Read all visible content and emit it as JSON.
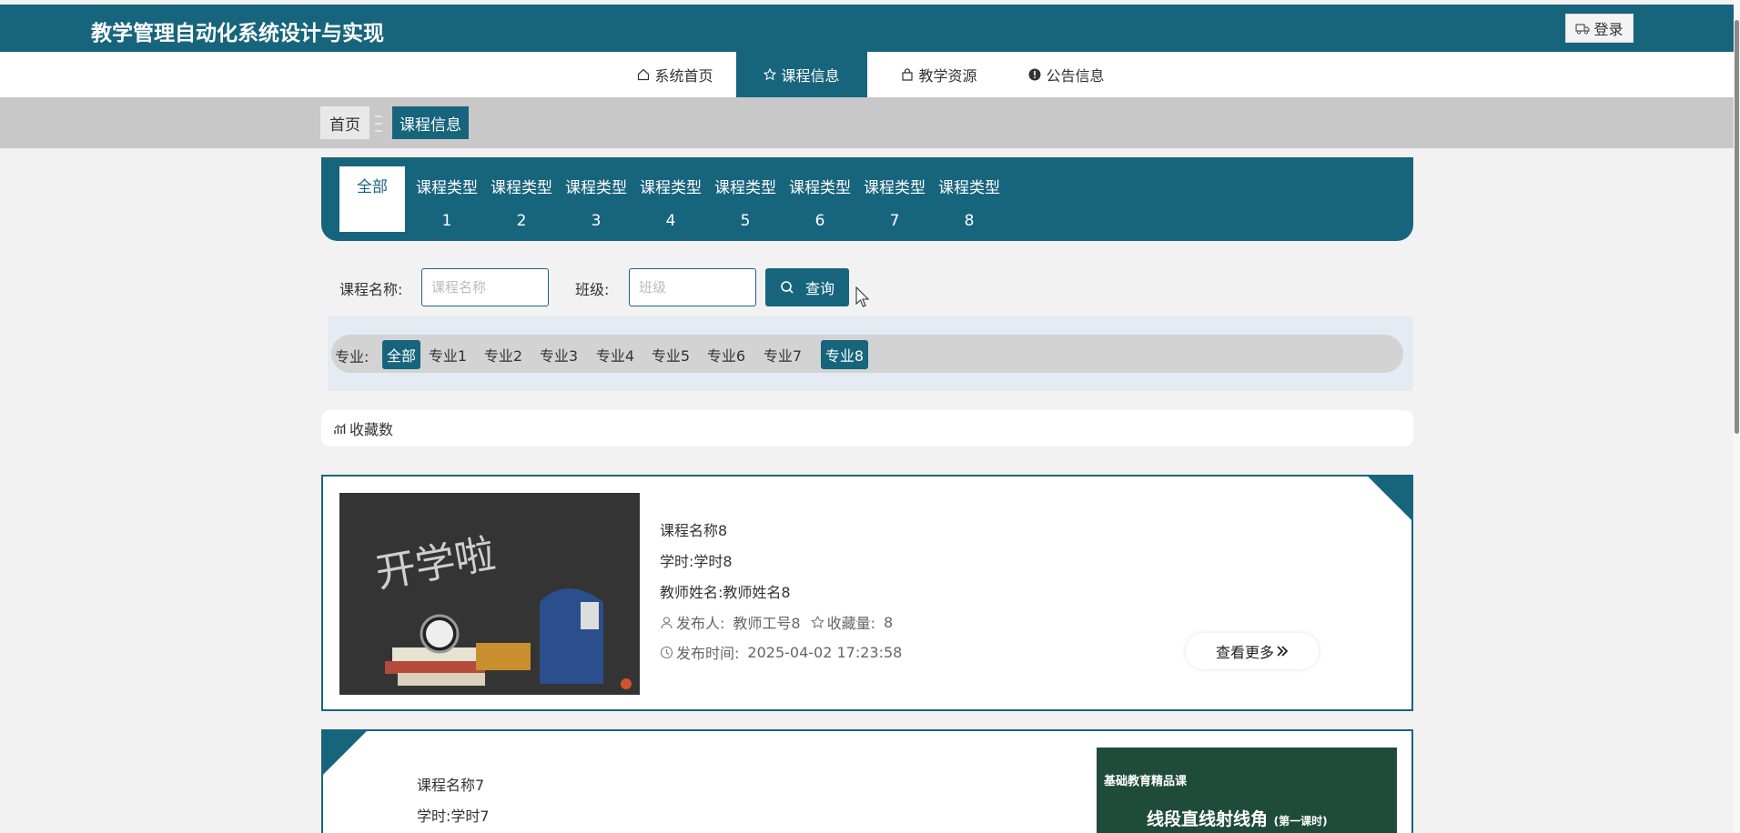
{
  "header": {
    "title": "教学管理自动化系统设计与实现",
    "login_label": "登录"
  },
  "nav": {
    "items": [
      {
        "label": "系统首页",
        "icon": "home-icon"
      },
      {
        "label": "课程信息",
        "icon": "star-icon",
        "active": true
      },
      {
        "label": "教学资源",
        "icon": "bag-icon"
      },
      {
        "label": "公告信息",
        "icon": "info-icon"
      }
    ]
  },
  "breadcrumb": {
    "home": "首页",
    "current": "课程信息"
  },
  "course_types": {
    "all": "全部",
    "items": [
      {
        "label": "课程类型",
        "num": "1"
      },
      {
        "label": "课程类型",
        "num": "2"
      },
      {
        "label": "课程类型",
        "num": "3"
      },
      {
        "label": "课程类型",
        "num": "4"
      },
      {
        "label": "课程类型",
        "num": "5"
      },
      {
        "label": "课程类型",
        "num": "6"
      },
      {
        "label": "课程类型",
        "num": "7"
      },
      {
        "label": "课程类型",
        "num": "8"
      }
    ]
  },
  "search": {
    "course_name_label": "课程名称:",
    "course_name_placeholder": "课程名称",
    "class_label": "班级:",
    "class_placeholder": "班级",
    "query_label": "查询"
  },
  "majors": {
    "label": "专业:",
    "items": [
      "全部",
      "专业1",
      "专业2",
      "专业3",
      "专业4",
      "专业5",
      "专业6",
      "专业7",
      "专业8"
    ],
    "active": [
      "全部",
      "专业8"
    ]
  },
  "sort": {
    "label": "收藏数"
  },
  "courses": [
    {
      "name": "课程名称8",
      "hours": "学时:学时8",
      "teacher": "教师姓名:教师姓名8",
      "publisher_label": "发布人:",
      "publisher": "教师工号8",
      "fav_label": "收藏量:",
      "fav": "8",
      "time_label": "发布时间:",
      "time": "2025-04-02 17:23:58",
      "more": "查看更多",
      "image_text": "开学啦"
    },
    {
      "name": "课程名称7",
      "hours": "学时:学时7",
      "image_caption": "基础教育精品课",
      "image_title": "线段直线射线角",
      "image_subtitle": "(第一课时)"
    }
  ],
  "colors": {
    "primary": "#17657d",
    "breadcrumb_bg": "#c8c8c8",
    "page_bg": "#f2f2f2"
  }
}
